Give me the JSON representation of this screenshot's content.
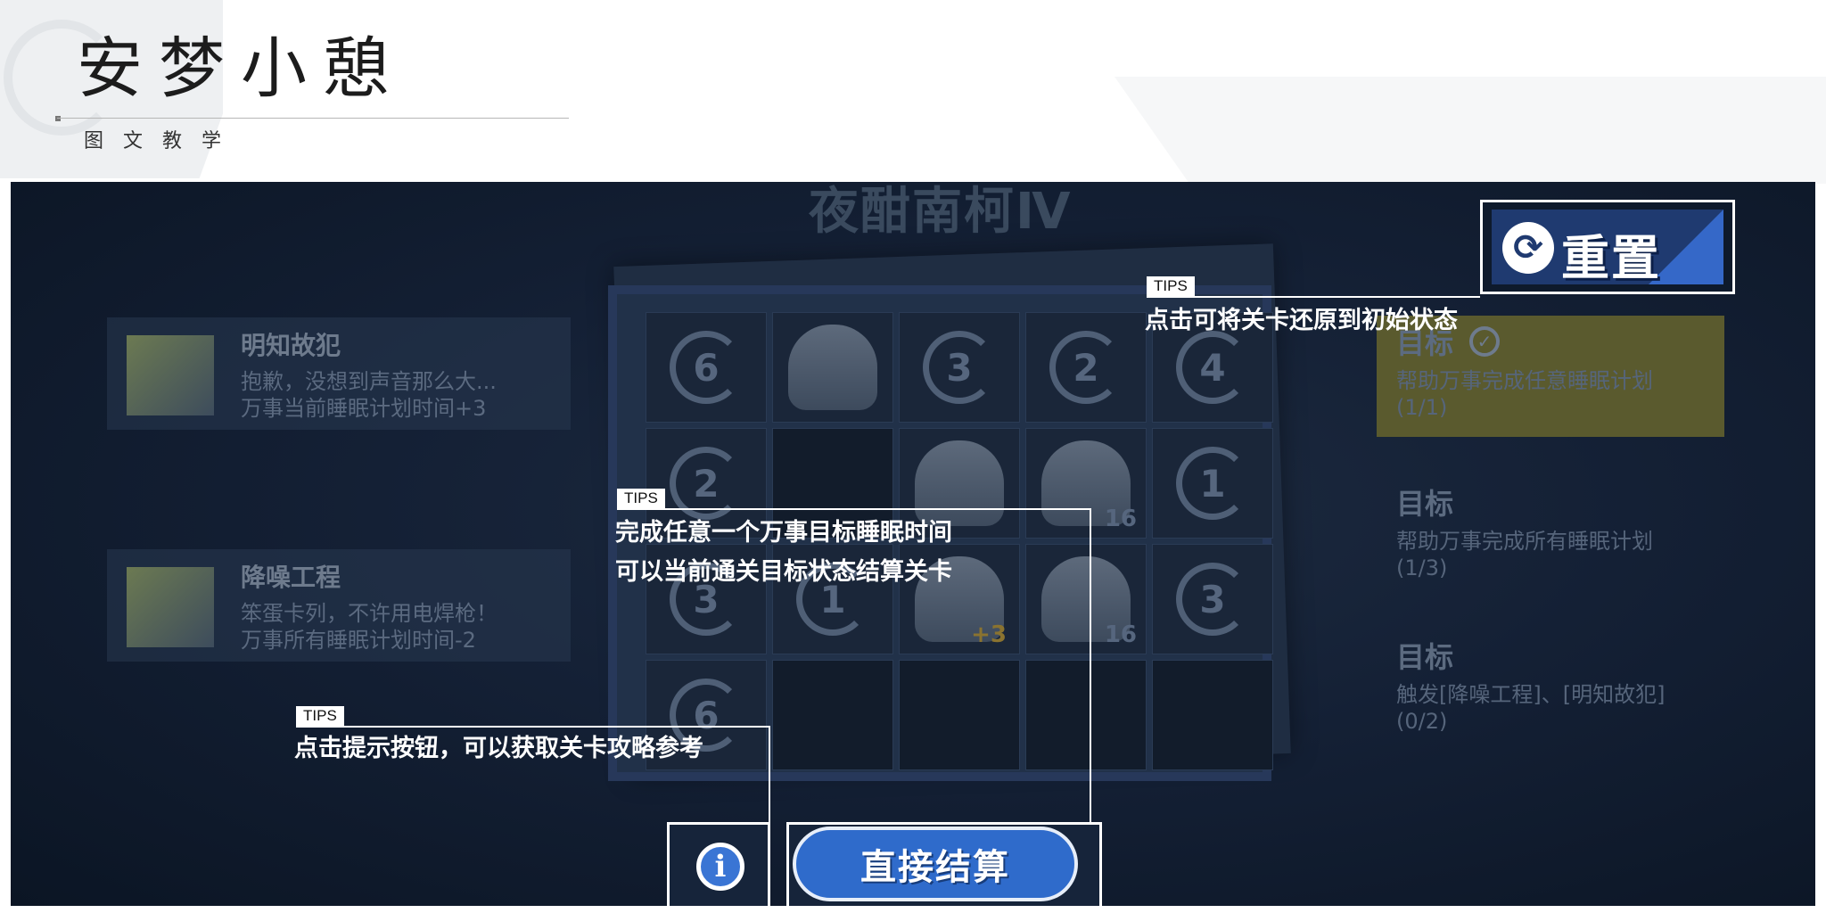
{
  "header": {
    "title": "安梦小憩",
    "subtitle": "图文教学"
  },
  "game": {
    "level_name": "夜酣南柯Ⅳ",
    "reset_button": {
      "label": "重置",
      "icon": "refresh-icon"
    },
    "hint_button": {
      "icon": "info-icon",
      "glyph": "i"
    },
    "settle_button": {
      "label": "直接结算"
    },
    "board": {
      "rows": [
        [
          {
            "type": "turns",
            "value": "6"
          },
          {
            "type": "character",
            "value": ""
          },
          {
            "type": "turns",
            "value": "3"
          },
          {
            "type": "turns",
            "value": "2"
          },
          {
            "type": "turns",
            "value": "4"
          }
        ],
        [
          {
            "type": "turns",
            "value": "2"
          },
          {
            "type": "empty",
            "value": ""
          },
          {
            "type": "character",
            "value": ""
          },
          {
            "type": "character",
            "value": "16"
          },
          {
            "type": "turns",
            "value": "1"
          }
        ],
        [
          {
            "type": "turns",
            "value": "3"
          },
          {
            "type": "turns",
            "value": "1"
          },
          {
            "type": "character",
            "value": "+3"
          },
          {
            "type": "character",
            "value": "16"
          },
          {
            "type": "turns",
            "value": "3"
          }
        ],
        [
          {
            "type": "turns",
            "value": "6"
          },
          {
            "type": "empty",
            "value": ""
          },
          {
            "type": "empty",
            "value": ""
          },
          {
            "type": "empty",
            "value": ""
          },
          {
            "type": "empty",
            "value": ""
          }
        ]
      ]
    },
    "events": [
      {
        "name": "明知故犯",
        "line1": "抱歉，没想到声音那么大...",
        "line2": "万事当前睡眠计划时间+3"
      },
      {
        "name": "降噪工程",
        "line1": "笨蛋卡列，不许用电焊枪！",
        "line2": "万事所有睡眠计划时间-2"
      }
    ],
    "objectives": [
      {
        "heading": "目标",
        "desc": "帮助万事完成任意睡眠计划(1/1)",
        "completed": true
      },
      {
        "heading": "目标",
        "desc": "帮助万事完成所有睡眠计划(1/3)",
        "completed": false
      },
      {
        "heading": "目标",
        "desc": "触发[降噪工程]、[明知故犯](0/2)",
        "completed": false
      }
    ]
  },
  "tips": [
    {
      "tag": "TIPS",
      "lines": [
        "点击可将关卡还原到初始状态"
      ]
    },
    {
      "tag": "TIPS",
      "lines": [
        "完成任意一个万事目标睡眠时间",
        "可以当前通关目标状态结算关卡"
      ]
    },
    {
      "tag": "TIPS",
      "lines": [
        "点击提示按钮，可以获取关卡攻略参考"
      ]
    }
  ],
  "colors": {
    "accent": "#2f6bcb",
    "background": "#142035",
    "tip_text": "#ffffff"
  }
}
